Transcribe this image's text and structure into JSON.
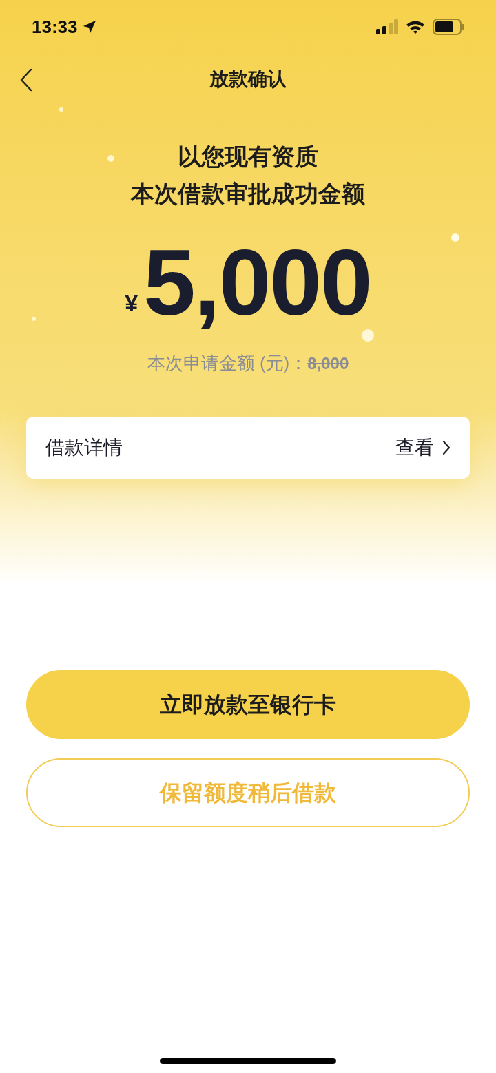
{
  "status_bar": {
    "time": "13:33"
  },
  "nav": {
    "title": "放款确认"
  },
  "headline": [
    "以您现有资质",
    "本次借款审批成功金额"
  ],
  "amount": {
    "currency": "¥",
    "value": "5,000"
  },
  "requested": {
    "label": "本次申请金额 (元)：",
    "value": "8,000",
    "struck": true
  },
  "details_row": {
    "label": "借款详情",
    "action": "查看"
  },
  "buttons": [
    {
      "label": "立即放款至银行卡",
      "kind": "primary"
    },
    {
      "label": "保留额度稍后借款",
      "kind": "outline"
    }
  ]
}
